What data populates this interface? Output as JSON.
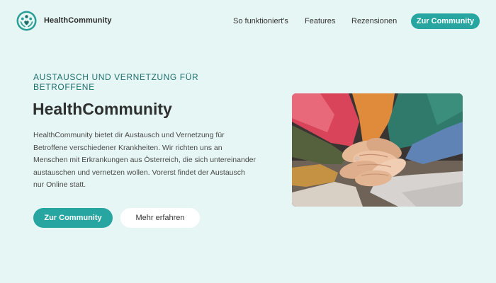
{
  "header": {
    "brand": "HealthCommunity",
    "logo_icon": "people-heart-logo-icon",
    "nav": {
      "how_it_works": "So funktioniert's",
      "features": "Features",
      "reviews": "Rezensionen"
    },
    "cta_label": "Zur Community"
  },
  "hero": {
    "eyebrow": "AUSTAUSCH UND VERNETZUNG FÜR BETROFFENE",
    "title": "HealthCommunity",
    "text": "HealthCommunity bietet dir Austausch und Vernetzung für Betroffene verschiedener Krankheiten. Wir richten uns an Menschen mit Erkrankungen aus Österreich, die sich untereinander austauschen und vernetzen wollen. Vorerst findet der Austausch nur Online statt.",
    "primary_button": "Zur Community",
    "secondary_button": "Mehr erfahren",
    "image_alt": "stacked-hands-photo"
  },
  "colors": {
    "background": "#e6f6f4",
    "accent": "#27a6a1",
    "eyebrow": "#20706f",
    "text": "#2d2d2d"
  }
}
